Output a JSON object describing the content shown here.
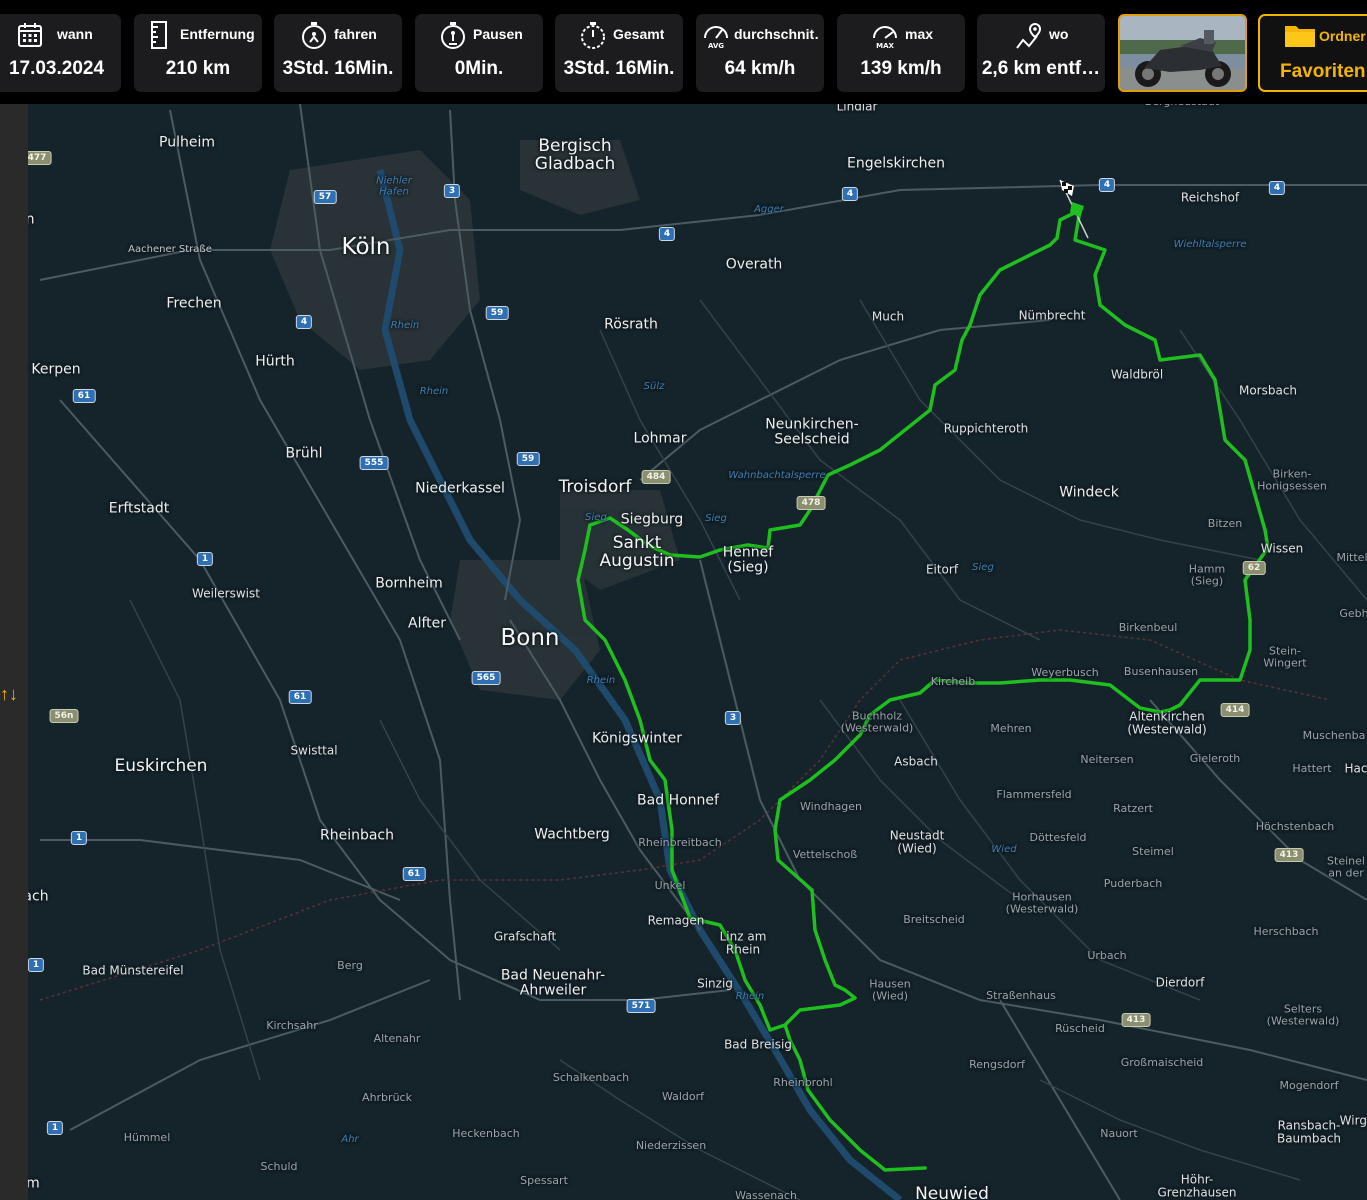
{
  "stats": [
    {
      "id": "date",
      "icon": "calendar-icon",
      "label": "wann",
      "value": "17.03.2024"
    },
    {
      "id": "distance",
      "icon": "ruler-icon",
      "label": "Entfernung",
      "value": "210 km"
    },
    {
      "id": "drive",
      "icon": "stopwatch-drive-icon",
      "label": "fahren",
      "value": "3Std. 16Min."
    },
    {
      "id": "pauses",
      "icon": "stopwatch-pause-icon",
      "label": "Pausen",
      "value": "0Min."
    },
    {
      "id": "total",
      "icon": "stopwatch-total-icon",
      "label": "Gesamt",
      "value": "3Std. 16Min."
    },
    {
      "id": "avg",
      "icon": "speedometer-avg-icon",
      "label": "durchschnit…",
      "icon_text": "AVG",
      "value": "64 km/h"
    },
    {
      "id": "max",
      "icon": "speedometer-max-icon",
      "label": "max",
      "icon_text": "MAX",
      "value": "139 km/h"
    },
    {
      "id": "where",
      "icon": "map-pin-route-icon",
      "label": "wo",
      "value": "2,6 km entf…"
    }
  ],
  "photo": {
    "icon": "motorcycle-photo"
  },
  "folder": {
    "icon": "folder-icon",
    "label": "Ordner",
    "value": "Favoriten"
  },
  "sidebar": {
    "icon": "sort-arrows-icon",
    "glyph": "↑↓"
  },
  "colors": {
    "route": "#1fbf1f",
    "accent": "#f2b600",
    "map_bg": "#15232a",
    "panel": "#1c1c1e"
  },
  "map": {
    "places": [
      {
        "name": "Lindlar",
        "size": "s"
      },
      {
        "name": "Bergneustadt",
        "size": "d"
      },
      {
        "name": "Pulheim",
        "size": "m"
      },
      {
        "name": "Bergisch\nGladbach",
        "size": "l"
      },
      {
        "name": "Engelskirchen",
        "size": "m"
      },
      {
        "name": "Reichshof",
        "size": "s"
      },
      {
        "name": "Köln",
        "size": "xl"
      },
      {
        "name": "Aachener Straße",
        "size": "street"
      },
      {
        "name": "Overath",
        "size": "m"
      },
      {
        "name": "Frechen",
        "size": "m"
      },
      {
        "name": "Rösrath",
        "size": "m"
      },
      {
        "name": "Much",
        "size": "s"
      },
      {
        "name": "Nümbrecht",
        "size": "s"
      },
      {
        "name": "Hürth",
        "size": "m"
      },
      {
        "name": "Kerpen",
        "size": "m"
      },
      {
        "name": "Waldbröl",
        "size": "s"
      },
      {
        "name": "Morsbach",
        "size": "s"
      },
      {
        "name": "Lohmar",
        "size": "m"
      },
      {
        "name": "Neunkirchen-\nSeelscheid",
        "size": "m"
      },
      {
        "name": "Ruppichteroth",
        "size": "s"
      },
      {
        "name": "Brühl",
        "size": "m"
      },
      {
        "name": "Niederkassel",
        "size": "m"
      },
      {
        "name": "Troisdorf",
        "size": "l"
      },
      {
        "name": "Windeck",
        "size": "m"
      },
      {
        "name": "Birken-\nHonigsessen",
        "size": "d"
      },
      {
        "name": "Erftstadt",
        "size": "m"
      },
      {
        "name": "Siegburg",
        "size": "m"
      },
      {
        "name": "Sankt\nAugustin",
        "size": "l"
      },
      {
        "name": "Hennef\n(Sieg)",
        "size": "m"
      },
      {
        "name": "Eitorf",
        "size": "s"
      },
      {
        "name": "Bitzen",
        "size": "d"
      },
      {
        "name": "Wissen",
        "size": "s"
      },
      {
        "name": "Mittel",
        "size": "d"
      },
      {
        "name": "Hamm\n(Sieg)",
        "size": "d"
      },
      {
        "name": "Bornheim",
        "size": "m"
      },
      {
        "name": "Weilerswist",
        "size": "s"
      },
      {
        "name": "Alfter",
        "size": "m"
      },
      {
        "name": "Bonn",
        "size": "xl"
      },
      {
        "name": "Birkenbeul",
        "size": "d"
      },
      {
        "name": "Gebh",
        "size": "d"
      },
      {
        "name": "Stein-\nWingert",
        "size": "d"
      },
      {
        "name": "Kircheib",
        "size": "d"
      },
      {
        "name": "Weyerbusch",
        "size": "d"
      },
      {
        "name": "Busenhausen",
        "size": "d"
      },
      {
        "name": "Buchholz\n(Westerwald)",
        "size": "d"
      },
      {
        "name": "Altenkirchen\n(Westerwald)",
        "size": "s"
      },
      {
        "name": "Mehren",
        "size": "d"
      },
      {
        "name": "Königswinter",
        "size": "m"
      },
      {
        "name": "Muschenba",
        "size": "d"
      },
      {
        "name": "Swisttal",
        "size": "s"
      },
      {
        "name": "Asbach",
        "size": "s"
      },
      {
        "name": "Neitersen",
        "size": "d"
      },
      {
        "name": "Gieleroth",
        "size": "d"
      },
      {
        "name": "Euskirchen",
        "size": "l"
      },
      {
        "name": "Hattert",
        "size": "d"
      },
      {
        "name": "Hac",
        "size": "s"
      },
      {
        "name": "Bad Honnef",
        "size": "m"
      },
      {
        "name": "Flammersfeld",
        "size": "d"
      },
      {
        "name": "Windhagen",
        "size": "d"
      },
      {
        "name": "Ratzert",
        "size": "d"
      },
      {
        "name": "Rheinbach",
        "size": "m"
      },
      {
        "name": "Wachtberg",
        "size": "m"
      },
      {
        "name": "Neustadt\n(Wied)",
        "size": "s"
      },
      {
        "name": "Döttesfeld",
        "size": "d"
      },
      {
        "name": "Höchstenbach",
        "size": "d"
      },
      {
        "name": "Rheinbreitbach",
        "size": "d"
      },
      {
        "name": "Vettelschoß",
        "size": "d"
      },
      {
        "name": "Steimel",
        "size": "d"
      },
      {
        "name": "Steinel\nan der",
        "size": "d"
      },
      {
        "name": "Unkel",
        "size": "d"
      },
      {
        "name": "Puderbach",
        "size": "d"
      },
      {
        "name": "ach",
        "size": "m"
      },
      {
        "name": "Horhausen\n(Westerwald)",
        "size": "d"
      },
      {
        "name": "Remagen",
        "size": "s"
      },
      {
        "name": "Breitscheid",
        "size": "d"
      },
      {
        "name": "Grafschaft",
        "size": "s"
      },
      {
        "name": "Linz am\nRhein",
        "size": "s"
      },
      {
        "name": "Herschbach",
        "size": "d"
      },
      {
        "name": "Bad Münstereifel",
        "size": "s"
      },
      {
        "name": "Berg",
        "size": "d"
      },
      {
        "name": "Urbach",
        "size": "d"
      },
      {
        "name": "Bad Neuenahr-\nAhrweiler",
        "size": "m"
      },
      {
        "name": "Sinzig",
        "size": "s"
      },
      {
        "name": "Dierdorf",
        "size": "s"
      },
      {
        "name": "Hausen\n(Wied)",
        "size": "d"
      },
      {
        "name": "Straßenhaus",
        "size": "d"
      },
      {
        "name": "Selters\n(Westerwald)",
        "size": "d"
      },
      {
        "name": "Kirchsahr",
        "size": "d"
      },
      {
        "name": "Rüscheid",
        "size": "d"
      },
      {
        "name": "Altenahr",
        "size": "d"
      },
      {
        "name": "Bad Breisig",
        "size": "s"
      },
      {
        "name": "Großmaischeid",
        "size": "d"
      },
      {
        "name": "Rengsdorf",
        "size": "d"
      },
      {
        "name": "Schalkenbach",
        "size": "d"
      },
      {
        "name": "Rheinbrohl",
        "size": "d"
      },
      {
        "name": "Mogendorf",
        "size": "d"
      },
      {
        "name": "Ahrbrück",
        "size": "d"
      },
      {
        "name": "Waldorf",
        "size": "d"
      },
      {
        "name": "Ransbach-\nBaumbach",
        "size": "s"
      },
      {
        "name": "Hümmel",
        "size": "d"
      },
      {
        "name": "Heckenbach",
        "size": "d"
      },
      {
        "name": "Nauort",
        "size": "d"
      },
      {
        "name": "Wirge",
        "size": "s"
      },
      {
        "name": "Niederzissen",
        "size": "d"
      },
      {
        "name": "Schuld",
        "size": "d"
      },
      {
        "name": "Spessart",
        "size": "d"
      },
      {
        "name": "Höhr-\nGrenzhausen",
        "size": "s"
      },
      {
        "name": "m",
        "size": "m"
      },
      {
        "name": "Wassenach",
        "size": "d"
      },
      {
        "name": "Neuwied",
        "size": "l"
      },
      {
        "name": "n",
        "size": "m"
      }
    ],
    "waters": [
      "Niehler\nHafen",
      "Rhein",
      "Rhein",
      "Sülz",
      "Wahnbachtalsperre",
      "Sieg",
      "Sieg",
      "Sieg",
      "Rhein",
      "Rhein",
      "Agger",
      "Wiehltalsperre",
      "Wied",
      "Ahr"
    ],
    "shields": [
      {
        "text": "477",
        "type": "b"
      },
      {
        "text": "57",
        "type": "a"
      },
      {
        "text": "3",
        "type": "a"
      },
      {
        "text": "4",
        "type": "a"
      },
      {
        "text": "4",
        "type": "a"
      },
      {
        "text": "4",
        "type": "a"
      },
      {
        "text": "4",
        "type": "a"
      },
      {
        "text": "4",
        "type": "a"
      },
      {
        "text": "59",
        "type": "a"
      },
      {
        "text": "61",
        "type": "a"
      },
      {
        "text": "555",
        "type": "a"
      },
      {
        "text": "59",
        "type": "a"
      },
      {
        "text": "484",
        "type": "b"
      },
      {
        "text": "478",
        "type": "b"
      },
      {
        "text": "1",
        "type": "a"
      },
      {
        "text": "62",
        "type": "b"
      },
      {
        "text": "565",
        "type": "a"
      },
      {
        "text": "61",
        "type": "a"
      },
      {
        "text": "56n",
        "type": "b"
      },
      {
        "text": "3",
        "type": "a"
      },
      {
        "text": "414",
        "type": "b"
      },
      {
        "text": "1",
        "type": "a"
      },
      {
        "text": "413",
        "type": "b"
      },
      {
        "text": "61",
        "type": "a"
      },
      {
        "text": "1",
        "type": "a"
      },
      {
        "text": "571",
        "type": "a"
      },
      {
        "text": "413",
        "type": "b"
      },
      {
        "text": "1",
        "type": "a"
      }
    ]
  }
}
